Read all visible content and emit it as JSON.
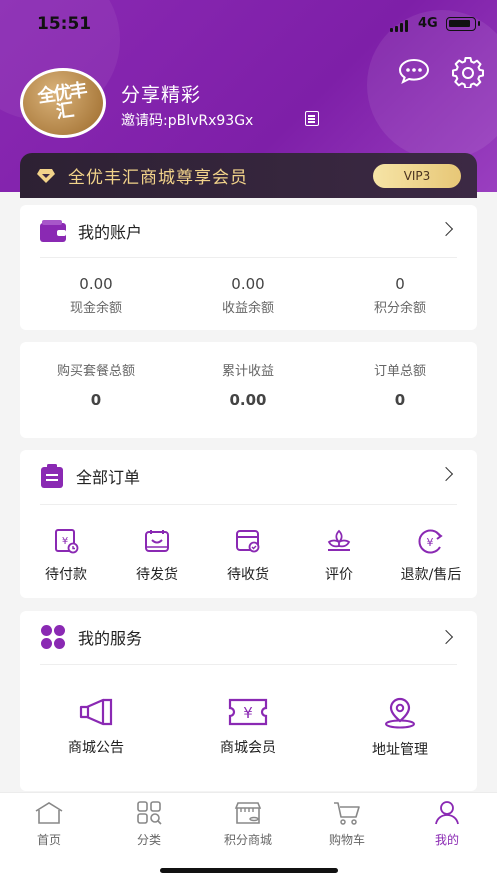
{
  "status": {
    "time": "15:51",
    "network": "4G"
  },
  "profile": {
    "name": "分享精彩",
    "invite_label": "邀请码:pBlvRx93Gx",
    "logo_text": "全优丰汇"
  },
  "vip": {
    "title": "全优丰汇商城尊享会员",
    "level": "VIP3"
  },
  "account": {
    "title": "我的账户",
    "stats": [
      {
        "value": "0.00",
        "label": "现金余额"
      },
      {
        "value": "0.00",
        "label": "收益余额"
      },
      {
        "value": "0",
        "label": "积分余额"
      }
    ]
  },
  "summary": {
    "stats": [
      {
        "label": "购买套餐总额",
        "value": "0"
      },
      {
        "label": "累计收益",
        "value": "0.00"
      },
      {
        "label": "订单总额",
        "value": "0"
      }
    ]
  },
  "orders": {
    "title": "全部订单",
    "items": [
      {
        "label": "待付款",
        "icon": "pending-payment-icon"
      },
      {
        "label": "待发货",
        "icon": "pending-shipment-icon"
      },
      {
        "label": "待收货",
        "icon": "pending-receipt-icon"
      },
      {
        "label": "评价",
        "icon": "review-icon"
      },
      {
        "label": "退款/售后",
        "icon": "refund-icon"
      }
    ]
  },
  "services": {
    "title": "我的服务",
    "items": [
      {
        "label": "商城公告",
        "icon": "megaphone-icon"
      },
      {
        "label": "商城会员",
        "icon": "member-ticket-icon"
      },
      {
        "label": "地址管理",
        "icon": "location-pin-icon"
      }
    ]
  },
  "tabbar": {
    "items": [
      {
        "label": "首页",
        "icon": "home-icon"
      },
      {
        "label": "分类",
        "icon": "category-icon"
      },
      {
        "label": "积分商城",
        "icon": "store-icon"
      },
      {
        "label": "购物车",
        "icon": "cart-icon"
      },
      {
        "label": "我的",
        "icon": "profile-icon",
        "active": true
      }
    ]
  },
  "colors": {
    "brand": "#8a29b3",
    "vip_gold": "#f2d38a"
  }
}
